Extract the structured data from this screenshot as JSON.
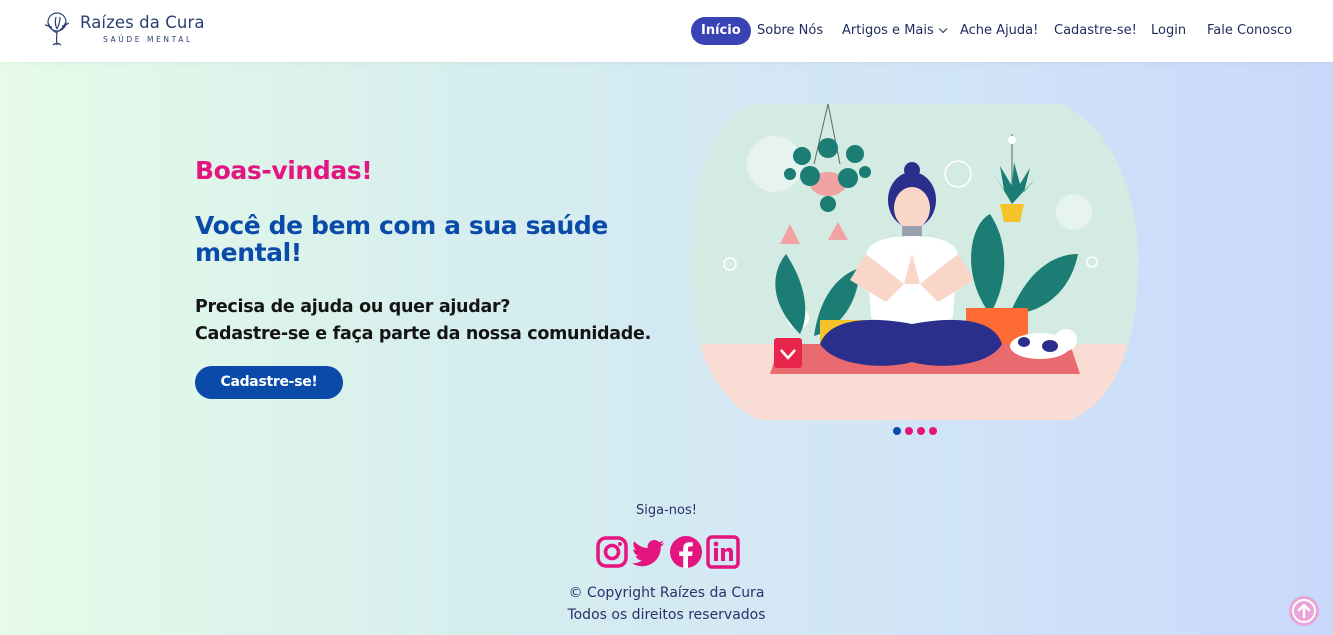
{
  "brand": {
    "name": "Raízes da Cura",
    "tagline": "SAÚDE MENTAL",
    "color": "#2a3f74"
  },
  "nav": {
    "items": [
      {
        "label": "Início",
        "active": true
      },
      {
        "label": "Sobre Nós"
      },
      {
        "label": "Artigos e Mais"
      },
      {
        "label": "Ache Ajuda!"
      },
      {
        "label": "Cadastre-se!"
      },
      {
        "label": "Login"
      },
      {
        "label": "Fale Conosco"
      }
    ],
    "active_color": "#3a43b4"
  },
  "hero": {
    "welcome": "Boas-vindas!",
    "title": "Você de bem com a sua saúde mental!",
    "line1": "Precisa de ajuda ou quer ajudar?",
    "line2": "Cadastre-se e faça parte da nossa comunidade.",
    "cta": "Cadastre-se!",
    "accent": "#e5157f",
    "primary": "#0a4aa8"
  },
  "carousel": {
    "slides": 4,
    "active_index": 0
  },
  "footer": {
    "follow": "Siga-nos!",
    "socials": [
      "instagram-icon",
      "twitter-icon",
      "facebook-icon",
      "linkedin-icon"
    ],
    "copyright": "© Copyright Raízes da Cura",
    "rights": "Todos os direitos reservados",
    "social_color": "#e5157f"
  },
  "back_to_top": {
    "icon": "arrow-up-icon"
  }
}
